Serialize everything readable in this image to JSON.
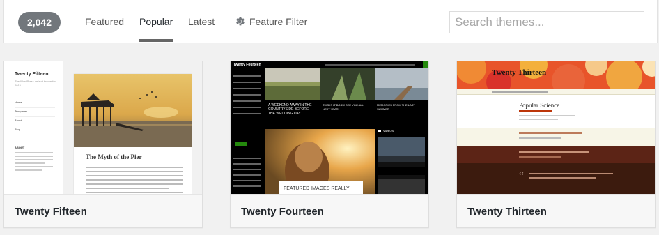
{
  "filter_bar": {
    "theme_count": "2,042",
    "tabs": [
      {
        "label": "Featured"
      },
      {
        "label": "Popular"
      },
      {
        "label": "Latest"
      }
    ],
    "feature_filter_label": "Feature Filter",
    "search_placeholder": "Search themes..."
  },
  "themes": [
    {
      "name": "Twenty Fifteen",
      "preview": {
        "site_title": "Twenty Fifteen",
        "tagline": "The WordPress default theme for 2015",
        "menu": [
          "Home",
          "Templates",
          "About",
          "Blog"
        ],
        "about_heading": "ABOUT",
        "post_title": "The Myth of the Pier"
      }
    },
    {
      "name": "Twenty Fourteen",
      "preview": {
        "site_title": "Twenty Fourteen",
        "caption1": "A WEEKEND AWAY IN THE COUNTRYSIDE BEFORE THE WEDDING DAY",
        "caption2": "THIS IS IT BOSS! SEE YOU ALL NEXT YEAR!",
        "caption3": "MEMORIES FROM THE LAST SUMMER",
        "featured": "FEATURED IMAGES REALLY",
        "sidebar_title": "VIDEOS"
      }
    },
    {
      "name": "Twenty Thirteen",
      "preview": {
        "site_title": "Twenty Thirteen",
        "post_title": "Popular Science"
      }
    }
  ],
  "colors": {
    "count_badge": "#72777c",
    "fourteen_accent": "#24890d",
    "thirteen_brown": "#5c2416",
    "thirteen_cream": "#f7f5e7"
  }
}
